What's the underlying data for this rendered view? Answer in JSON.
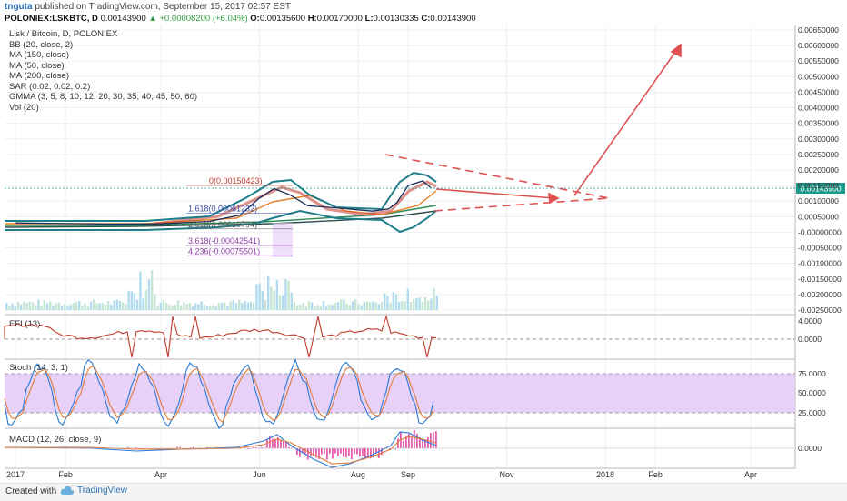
{
  "header": {
    "user": "tnguta",
    "published": "published on TradingView.com, September 15, 2017 02:57 EST",
    "symbol": "POLONIEX:LSKBTC, D",
    "last": "0.00143900",
    "change": "▲ +0.00008200 (+6.04%)",
    "open_label": "O:",
    "open": "0.00135600",
    "high_label": "H:",
    "high": "0.00170000",
    "low_label": "L:",
    "low": "0.00130335",
    "close_label": "C:",
    "close": "0.00143900"
  },
  "legend": {
    "title": "Lisk / Bitcoin, D, POLONIEX",
    "indicators": [
      "BB (20, close, 2)",
      "MA (150, close)",
      "MA (50, close)",
      "MA (200, close)",
      "SAR (0.02, 0.02, 0.2)",
      "GMMA (3, 5, 8, 10, 12, 20, 30, 35, 40, 45, 50, 60)",
      "Vol (20)"
    ]
  },
  "panes": {
    "efi": "EFI (13)",
    "stoch": "Stoch (14, 3, 1)",
    "macd": "MACD (12, 26, close, 9)"
  },
  "footer": {
    "created_with": "Created with",
    "brand": "TradingView"
  },
  "colors": {
    "price": "#1a2c5b",
    "bb": "#1e7e8a",
    "ma150": "#2e8b57",
    "ma50": "#e67e22",
    "ma200": "#2f4f4f",
    "arrow": "#e05252",
    "stoch_fill": "#e4c9f7",
    "stoch_k": "#2b7bd6",
    "stoch_d": "#e07b39",
    "efi": "#c0392b",
    "macd_hist": "#e0379a",
    "price_label_bg": "#1b9a8a"
  },
  "chart_data": {
    "type": "line",
    "title": "Lisk / Bitcoin, D, POLONIEX",
    "x_ticks": [
      "2017",
      "Feb",
      "Apr",
      "Jun",
      "Aug",
      "Sep",
      "Nov",
      "2018",
      "Feb",
      "Apr"
    ],
    "price_axis": [
      "0.00650000",
      "0.00600000",
      "0.00550000",
      "0.00500000",
      "0.00450000",
      "0.00400000",
      "0.00350000",
      "0.00300000",
      "0.00250000",
      "0.00200000",
      "0.00150000",
      "0.00100000",
      "0.00050000",
      "-0.00000000",
      "-0.00050000",
      "-0.00100000",
      "-0.00150000",
      "-0.00200000",
      "-0.00250000"
    ],
    "price_axis_range": [
      -0.0025,
      0.0065
    ],
    "current_price_label": "0.00143900",
    "series": [
      {
        "name": "LSKBTC",
        "x": [
          "2017-01-01",
          "2017-02-01",
          "2017-03-01",
          "2017-04-01",
          "2017-05-01",
          "2017-05-20",
          "2017-06-01",
          "2017-06-10",
          "2017-06-20",
          "2017-07-01",
          "2017-07-15",
          "2017-08-01",
          "2017-08-10",
          "2017-08-20",
          "2017-08-25",
          "2017-09-01",
          "2017-09-10",
          "2017-09-15"
        ],
        "values": [
          0.0003,
          0.00028,
          0.00026,
          0.00027,
          0.00035,
          0.00055,
          0.0011,
          0.0014,
          0.0012,
          0.00085,
          0.0008,
          0.00072,
          0.00068,
          0.00075,
          0.00095,
          0.0015,
          0.00165,
          0.00143
        ]
      }
    ],
    "fibonacci": [
      {
        "level": "0",
        "value": "0.00150423"
      },
      {
        "level": "1.618",
        "value": "0.00061232"
      },
      {
        "level": "2.618",
        "value": "0.00010794"
      },
      {
        "level": "3.618",
        "value": "-0.00042541"
      },
      {
        "level": "4.236",
        "value": "-0.00075501"
      }
    ],
    "efi_axis": [
      "4.0000",
      "0.0000"
    ],
    "stoch_axis": [
      "75.0000",
      "50.0000",
      "25.0000"
    ],
    "macd_axis": [
      "0.0000"
    ],
    "grid": true
  }
}
